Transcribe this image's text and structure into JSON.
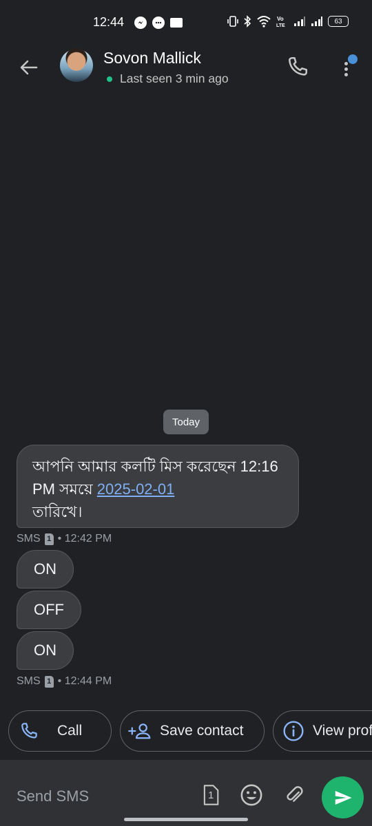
{
  "status_bar": {
    "time": "12:44",
    "battery": "63",
    "left_icons": [
      "messenger-icon",
      "chat-bubble-icon",
      "book-icon"
    ],
    "right_icons": [
      "vibrate-icon",
      "bluetooth-icon",
      "wifi-icon",
      "volte-icon",
      "signal-icon",
      "signal-icon",
      "battery-icon"
    ]
  },
  "header": {
    "contact_name": "Sovon Mallick",
    "presence": "Last seen 3 min ago",
    "online_color": "#1ec28b"
  },
  "chat": {
    "date_chip": "Today",
    "messages": [
      {
        "text_before": "আপনি আমার কলটি মিস করেছেন 12:16 PM সময়ে",
        "link": "2025-02-01",
        "text_after": "তারিখে।"
      },
      {
        "text": "ON"
      },
      {
        "text": "OFF"
      },
      {
        "text": "ON"
      }
    ],
    "meta": [
      {
        "channel": "SMS",
        "sim": "1",
        "time": "• 12:42 PM"
      },
      {
        "channel": "SMS",
        "sim": "1",
        "time": "• 12:44 PM"
      }
    ]
  },
  "suggestions": [
    {
      "label": "Call",
      "icon": "phone-icon"
    },
    {
      "label": "Save contact",
      "icon": "add-person-icon"
    },
    {
      "label": "View profile",
      "icon": "info-icon"
    }
  ],
  "composer": {
    "placeholder": "Send SMS",
    "sim": "1",
    "send_color": "#1fb46e"
  }
}
